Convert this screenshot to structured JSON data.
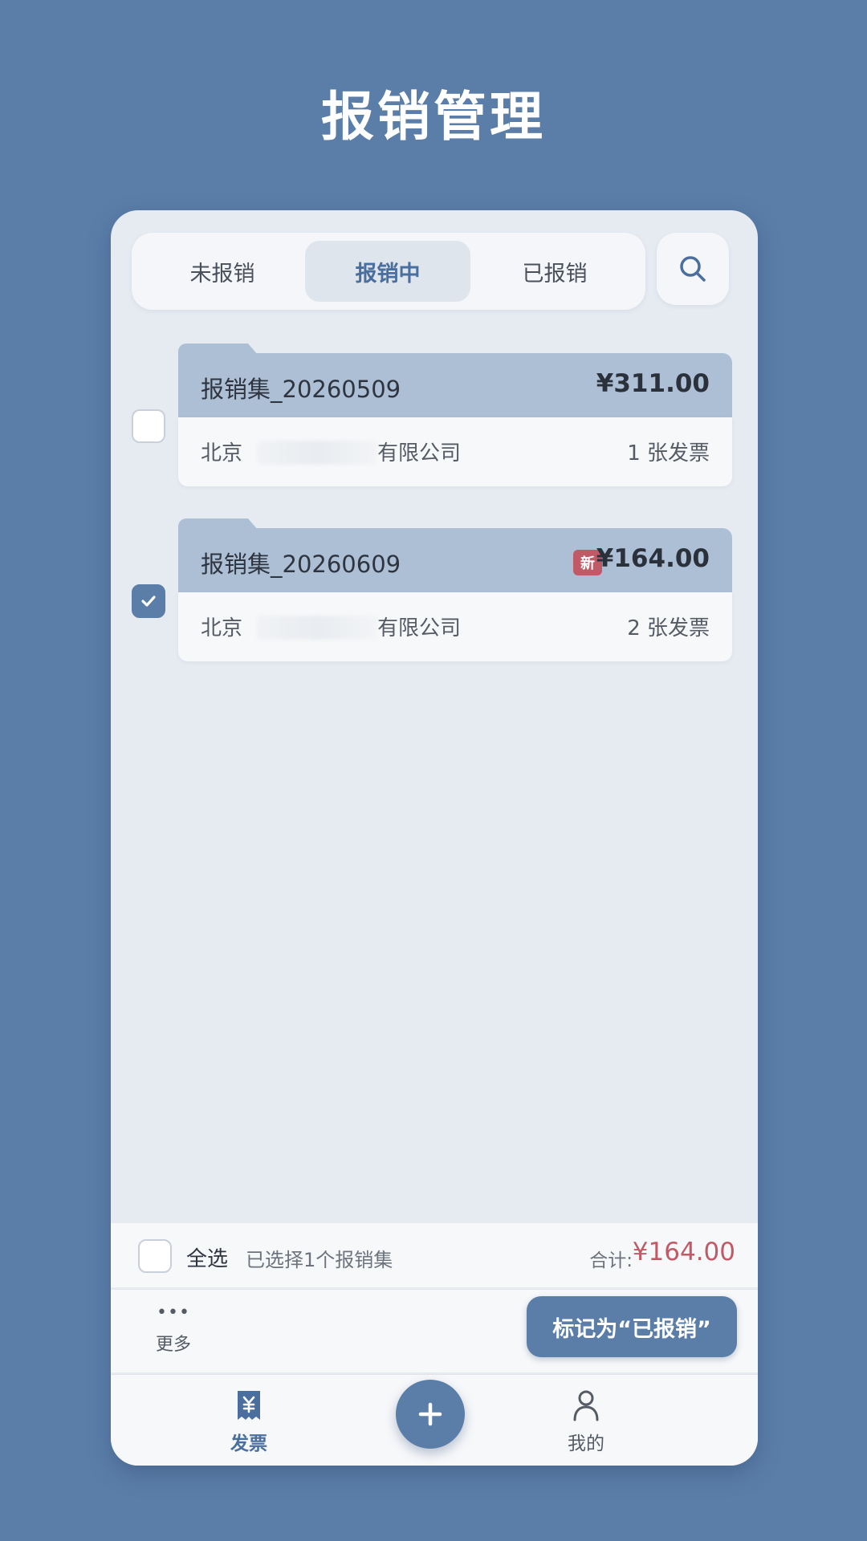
{
  "page": {
    "title": "报销管理"
  },
  "tabs": [
    {
      "label": "未报销",
      "active": false
    },
    {
      "label": "报销中",
      "active": true
    },
    {
      "label": "已报销",
      "active": false
    }
  ],
  "search": {
    "icon": "search-icon"
  },
  "reports": [
    {
      "name": "报销集_20260509",
      "amount": "¥311.00",
      "company_prefix": "北京",
      "company_suffix": "有限公司",
      "count": "1 张发票",
      "is_new": false,
      "checked": false
    },
    {
      "name": "报销集_20260609",
      "amount": "¥164.00",
      "company_prefix": "北京",
      "company_suffix": "有限公司",
      "count": "2 张发票",
      "new_badge": "新",
      "is_new": true,
      "checked": true
    }
  ],
  "selection": {
    "select_all_label": "全选",
    "selected_info": "已选择1个报销集",
    "total_label": "合计:",
    "total_amount": "¥164.00"
  },
  "actions": {
    "more_label": "更多",
    "more_icon": "more-dots-icon",
    "mark_label": "标记为“已报销”"
  },
  "nav": {
    "invoice_label": "发票",
    "invoice_icon": "invoice-yuan-icon",
    "add_icon": "plus-icon",
    "mine_label": "我的",
    "mine_icon": "person-icon"
  },
  "colors": {
    "background": "#5b7ea9",
    "accent": "#5b7ea9",
    "card_header": "#adbfd5",
    "highlight_red": "#c05a66"
  }
}
